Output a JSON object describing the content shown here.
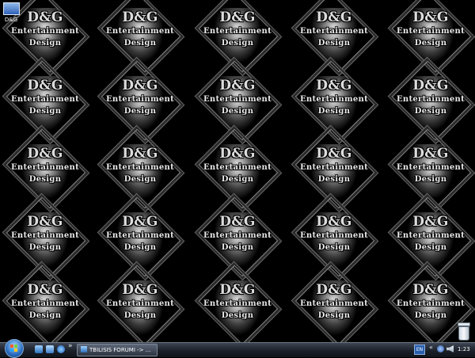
{
  "wallpaper": {
    "line1": "D&G",
    "line2": "Entertainment",
    "line3": "Design"
  },
  "desktop": {
    "icons": [
      {
        "label": "D&G",
        "icon": "dg-shortcut-icon"
      },
      {
        "label": "",
        "icon": "recycle-bin-icon"
      }
    ]
  },
  "taskbar": {
    "start_icon": "windows-orb-icon",
    "quick_launch": [
      "show-desktop-icon",
      "switch-windows-icon",
      "internet-explorer-icon"
    ],
    "quick_launch_more": "»",
    "open_window_label": "TBILISIS FORUMI -> ...",
    "language": "EN",
    "tray_arrow": "«",
    "clock": "1:23"
  },
  "colors": {
    "background": "#000000",
    "taskbar": "#1b2029",
    "accent": "#2b6cc0"
  }
}
